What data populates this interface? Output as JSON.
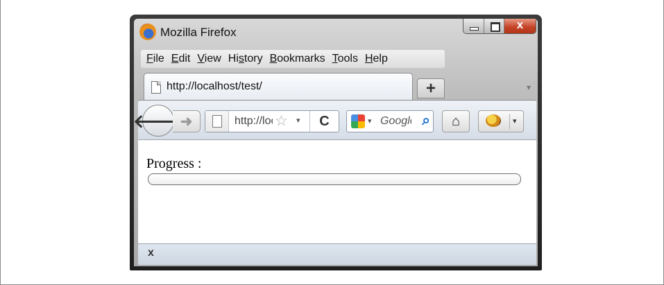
{
  "window": {
    "title": "Mozilla Firefox",
    "controls": {
      "minimize": "minimize",
      "maximize": "maximize",
      "close": "x"
    }
  },
  "menubar": {
    "items": [
      {
        "mnemonic": "F",
        "rest": "ile"
      },
      {
        "mnemonic": "E",
        "rest": "dit"
      },
      {
        "mnemonic": "V",
        "rest": "iew"
      },
      {
        "pre": "Hi",
        "mnemonic": "s",
        "rest": "tory"
      },
      {
        "mnemonic": "B",
        "rest": "ookmarks"
      },
      {
        "mnemonic": "T",
        "rest": "ools"
      },
      {
        "mnemonic": "H",
        "rest": "elp"
      }
    ]
  },
  "tabs": [
    {
      "title": "http://localhost/test/",
      "icon": "page-icon"
    }
  ],
  "new_tab_label": "+",
  "tab_list_arrow": "▾",
  "navbar": {
    "back_icon": "back-arrow-icon",
    "back_glyph": "🡐",
    "forward_glyph": "➜",
    "url_text": "http://localhost/test/",
    "star_glyph": "☆",
    "dropdown_glyph": "▾",
    "reload_glyph": "C",
    "search_engine_icon": "google-icon",
    "search_text": "Google",
    "search_glyph": "ϼ",
    "home_glyph": "⌂",
    "addon_icon": "ladybug-icon",
    "addon_dropdown_glyph": "▾"
  },
  "page": {
    "progress_label": "Progress :",
    "progress_value": 0
  },
  "statusbar": {
    "close_label": "x"
  },
  "colors": {
    "close_button": "#c44327",
    "google_icon": [
      "#4a90e2",
      "#e94235",
      "#34a853",
      "#fbbc05"
    ],
    "progress_fill": "#6fb3e6"
  }
}
